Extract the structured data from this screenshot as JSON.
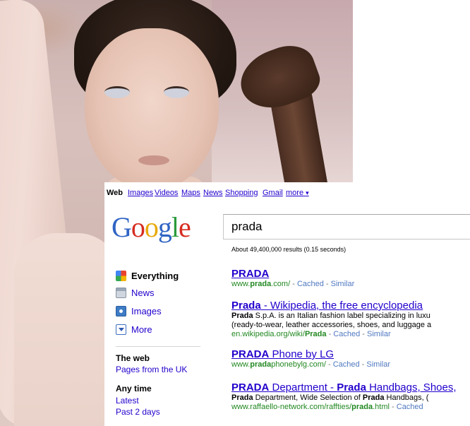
{
  "topbar": {
    "items": [
      "Web",
      "Images",
      "Videos",
      "Maps",
      "News",
      "Shopping",
      "Gmail",
      "more"
    ],
    "more_arrow": "▾"
  },
  "logo": {
    "letters": [
      "G",
      "o",
      "o",
      "g",
      "l",
      "e"
    ]
  },
  "search": {
    "query": "prada"
  },
  "stats": "About 49,400,000 results (0.15 seconds)",
  "left_nav": {
    "items": [
      {
        "label": "Everything",
        "icon": "everything-icon",
        "active": true
      },
      {
        "label": "News",
        "icon": "news-icon",
        "active": false
      },
      {
        "label": "Images",
        "icon": "images-icon",
        "active": false
      },
      {
        "label": "More",
        "icon": "more-dropdown-icon",
        "active": false
      }
    ],
    "web_heading": "The web",
    "web_link": "Pages from the UK",
    "time_heading": "Any time",
    "time_links": [
      "Latest",
      "Past 2 days"
    ]
  },
  "results": [
    {
      "title_bold": "PRADA",
      "title_rest": "",
      "snippet": [],
      "url_pre": "www.",
      "url_bold": "prada",
      "url_post": ".com/",
      "cached": "Cached",
      "similar": "Similar"
    },
    {
      "title_bold": "Prada",
      "title_rest": " - Wikipedia, the free encyclopedia",
      "snippet_bold": "Prada",
      "snippet_rest": " S.p.A. is an Italian fashion label specializing in luxu",
      "snippet_line2": "(ready-to-wear, leather accessories, shoes, and luggage a",
      "url_pre": "en.wikipedia.org/wiki/",
      "url_bold": "Prada",
      "url_post": "",
      "cached": "Cached",
      "similar": "Similar"
    },
    {
      "title_bold": "PRADA",
      "title_rest": " Phone by LG",
      "url_pre": "www.",
      "url_bold": "prada",
      "url_post": "phonebylg.com/",
      "cached": "Cached",
      "similar": "Similar"
    },
    {
      "title_bold": "PRADA",
      "title_mid": " Department - ",
      "title_bold2": "Prada",
      "title_rest": " Handbags, Shoes,",
      "snippet_bold": "Prada",
      "snippet_rest": " Department, Wide Selection of ",
      "snippet_bold2": "Prada",
      "snippet_rest2": " Handbags, (",
      "url_pre": "www.raffaello-network.com/raffties/",
      "url_bold": "prada",
      "url_post": ".html",
      "cached": "Cached"
    }
  ],
  "url_separator": " - ",
  "colors": {
    "link": "#2200cc",
    "url_green": "#228822",
    "meta_blue": "#4f78c0"
  }
}
